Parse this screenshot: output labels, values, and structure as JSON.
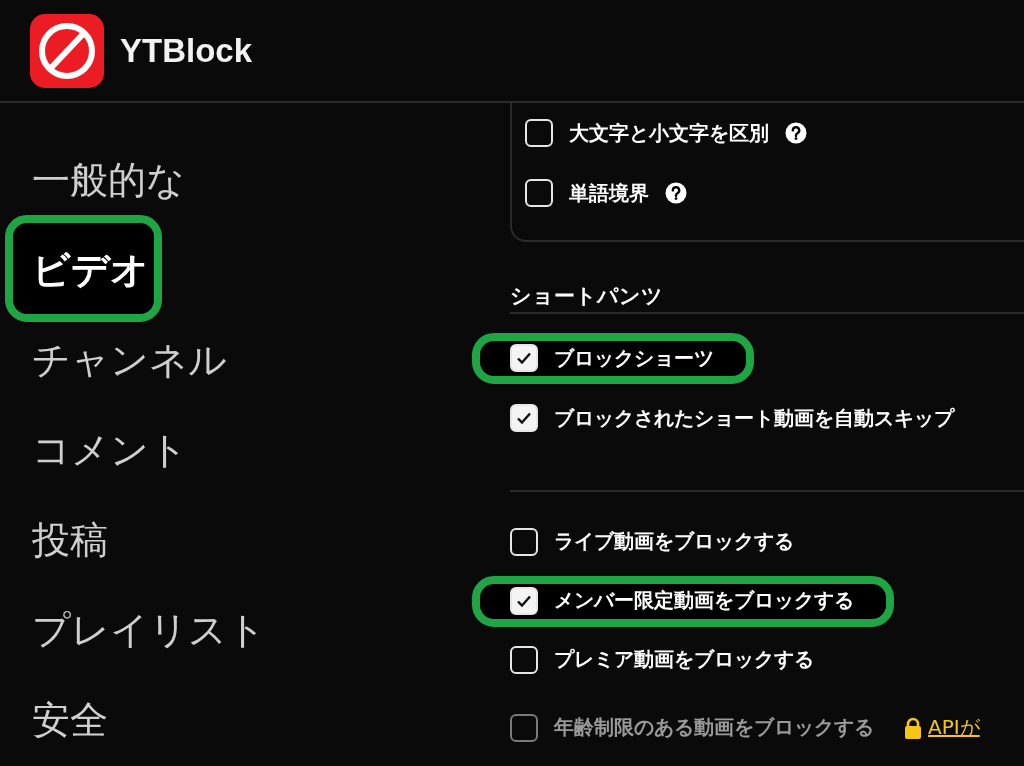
{
  "app": {
    "name": "YTBlock"
  },
  "sidebar": {
    "items": [
      {
        "label": "一般的な",
        "selected": false,
        "highlighted": false
      },
      {
        "label": "ビデオ",
        "selected": true,
        "highlighted": true
      },
      {
        "label": "チャンネル",
        "selected": false,
        "highlighted": false
      },
      {
        "label": "コメント",
        "selected": false,
        "highlighted": false
      },
      {
        "label": "投稿",
        "selected": false,
        "highlighted": false
      },
      {
        "label": "プレイリスト",
        "selected": false,
        "highlighted": false
      },
      {
        "label": "安全",
        "selected": false,
        "highlighted": false
      }
    ]
  },
  "filter_card": {
    "options": [
      {
        "label": "大文字と小文字を区別",
        "checked": false,
        "help": true
      },
      {
        "label": "単語境界",
        "checked": false,
        "help": true
      }
    ]
  },
  "shorts": {
    "heading": "ショートパンツ",
    "options": [
      {
        "label": "ブロックショーツ",
        "checked": true,
        "highlighted": true,
        "disabled": false
      },
      {
        "label": "ブロックされたショート動画を自動スキップ",
        "checked": true,
        "highlighted": false,
        "disabled": false
      }
    ]
  },
  "video_options": [
    {
      "label": "ライブ動画をブロックする",
      "checked": false,
      "highlighted": false,
      "disabled": false
    },
    {
      "label": "メンバー限定動画をブロックする",
      "checked": true,
      "highlighted": true,
      "disabled": false
    },
    {
      "label": "プレミア動画をブロックする",
      "checked": false,
      "highlighted": false,
      "disabled": false
    },
    {
      "label": "年齢制限のある動画をブロックする",
      "checked": false,
      "highlighted": false,
      "disabled": true,
      "link": {
        "text": "APIが",
        "locked": true
      }
    }
  ]
}
